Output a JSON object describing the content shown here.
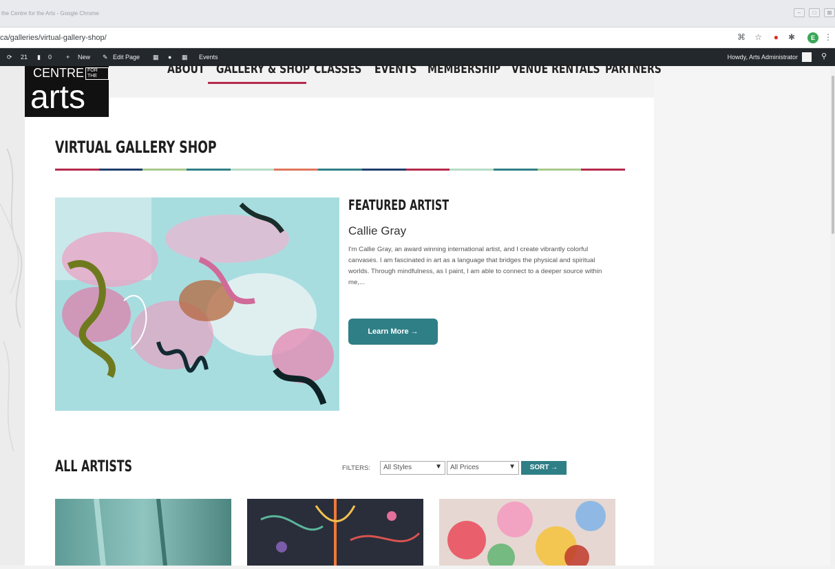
{
  "browser": {
    "window_title": "the Centre for the Arts - Google Chrome",
    "url": "ca/galleries/virtual-gallery-shop/",
    "profile_initial": "E"
  },
  "admin_bar": {
    "updates": "21",
    "comments": "0",
    "new_label": "New",
    "edit_label": "Edit Page",
    "events_label": "Events",
    "howdy": "Howdy, Arts Administrator"
  },
  "logo": {
    "line1": "CENTRE",
    "small": "FOR THE",
    "line2": "arts"
  },
  "nav": {
    "items": [
      "ABOUT",
      "GALLERY & SHOP",
      "CLASSES",
      "EVENTS",
      "MEMBERSHIP",
      "VENUE RENTALS",
      "PARTNERS"
    ],
    "active_index": 1
  },
  "page": {
    "title": "VIRTUAL GALLERY SHOP",
    "divider_colors": [
      "#b5294b",
      "#1f3d6b",
      "#a7c98a",
      "#2f7f86",
      "#b5dbc3",
      "#e0765a",
      "#2f7f86",
      "#1f3d6b",
      "#b5294b",
      "#b5dbc3",
      "#2f7f86",
      "#a7c98a",
      "#b5294b"
    ]
  },
  "featured": {
    "heading": "FEATURED ARTIST",
    "name": "Callie Gray",
    "bio": "I'm Callie Gray, an award winning international artist, and I create vibrantly colorful canvases. I am fascinated in art as a language that bridges the physical and spiritual worlds. Through mindfulness, as I paint, I am able to connect to a deeper source within me,...",
    "button": "Learn More →"
  },
  "all_artists": {
    "heading": "ALL ARTISTS",
    "filters_label": "FILTERS:",
    "style_select": "All Styles",
    "price_select": "All Prices",
    "sort_button": "SORT →"
  },
  "colors": {
    "accent_teal": "#2f7f86",
    "accent_red": "#b5294b",
    "admin_bar": "#23282d"
  }
}
